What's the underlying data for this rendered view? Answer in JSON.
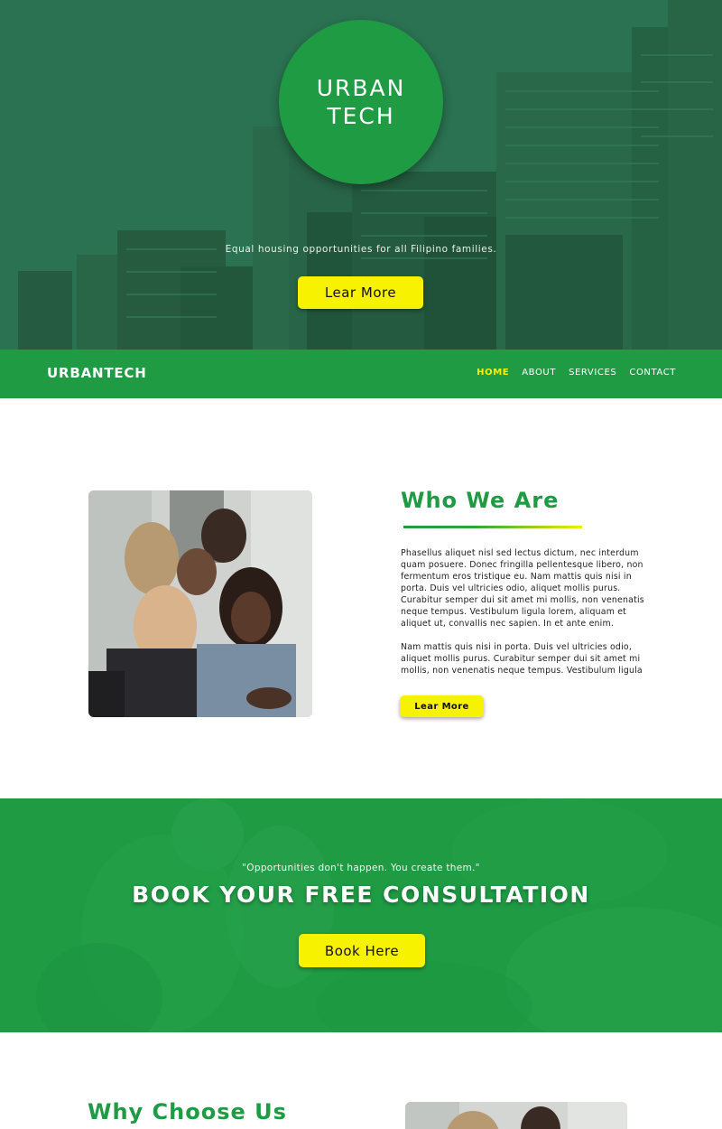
{
  "hero": {
    "badge_line1": "URBAN",
    "badge_line2": "TECH",
    "tagline": "Equal housing opportunities for all Filipino families.",
    "button_label": "Lear More"
  },
  "nav": {
    "logo": "URBANTECH",
    "links": [
      {
        "label": "HOME",
        "active": true
      },
      {
        "label": "ABOUT",
        "active": false
      },
      {
        "label": "SERVICES",
        "active": false
      },
      {
        "label": "CONTACT",
        "active": false
      }
    ]
  },
  "who": {
    "title": "Who We Are",
    "paragraph1": "Phasellus aliquet nisl sed lectus dictum, nec interdum quam posuere. Donec fringilla pellentesque libero, non fermentum eros tristique eu. Nam mattis quis nisi in porta. Duis vel ultricies odio, aliquet mollis purus. Curabitur semper dui sit amet mi mollis, non venenatis neque tempus. Vestibulum ligula lorem, aliquam et aliquet ut, convallis nec sapien. In et ante enim.",
    "paragraph2": "Nam mattis quis nisi in porta. Duis vel ultricies odio, aliquet mollis purus. Curabitur semper dui sit amet mi mollis, non venenatis neque tempus. Vestibulum ligula",
    "button_label": "Lear More"
  },
  "cta": {
    "quote": "\"Opportunities don't happen. You create them.\"",
    "title": "BOOK YOUR FREE CONSULTATION",
    "button_label": "Book Here"
  },
  "why": {
    "title": "Why Choose Us"
  },
  "colors": {
    "brand_green": "#1f9b44",
    "accent_yellow": "#f7f300",
    "hero_overlay": "#2a6a52"
  }
}
